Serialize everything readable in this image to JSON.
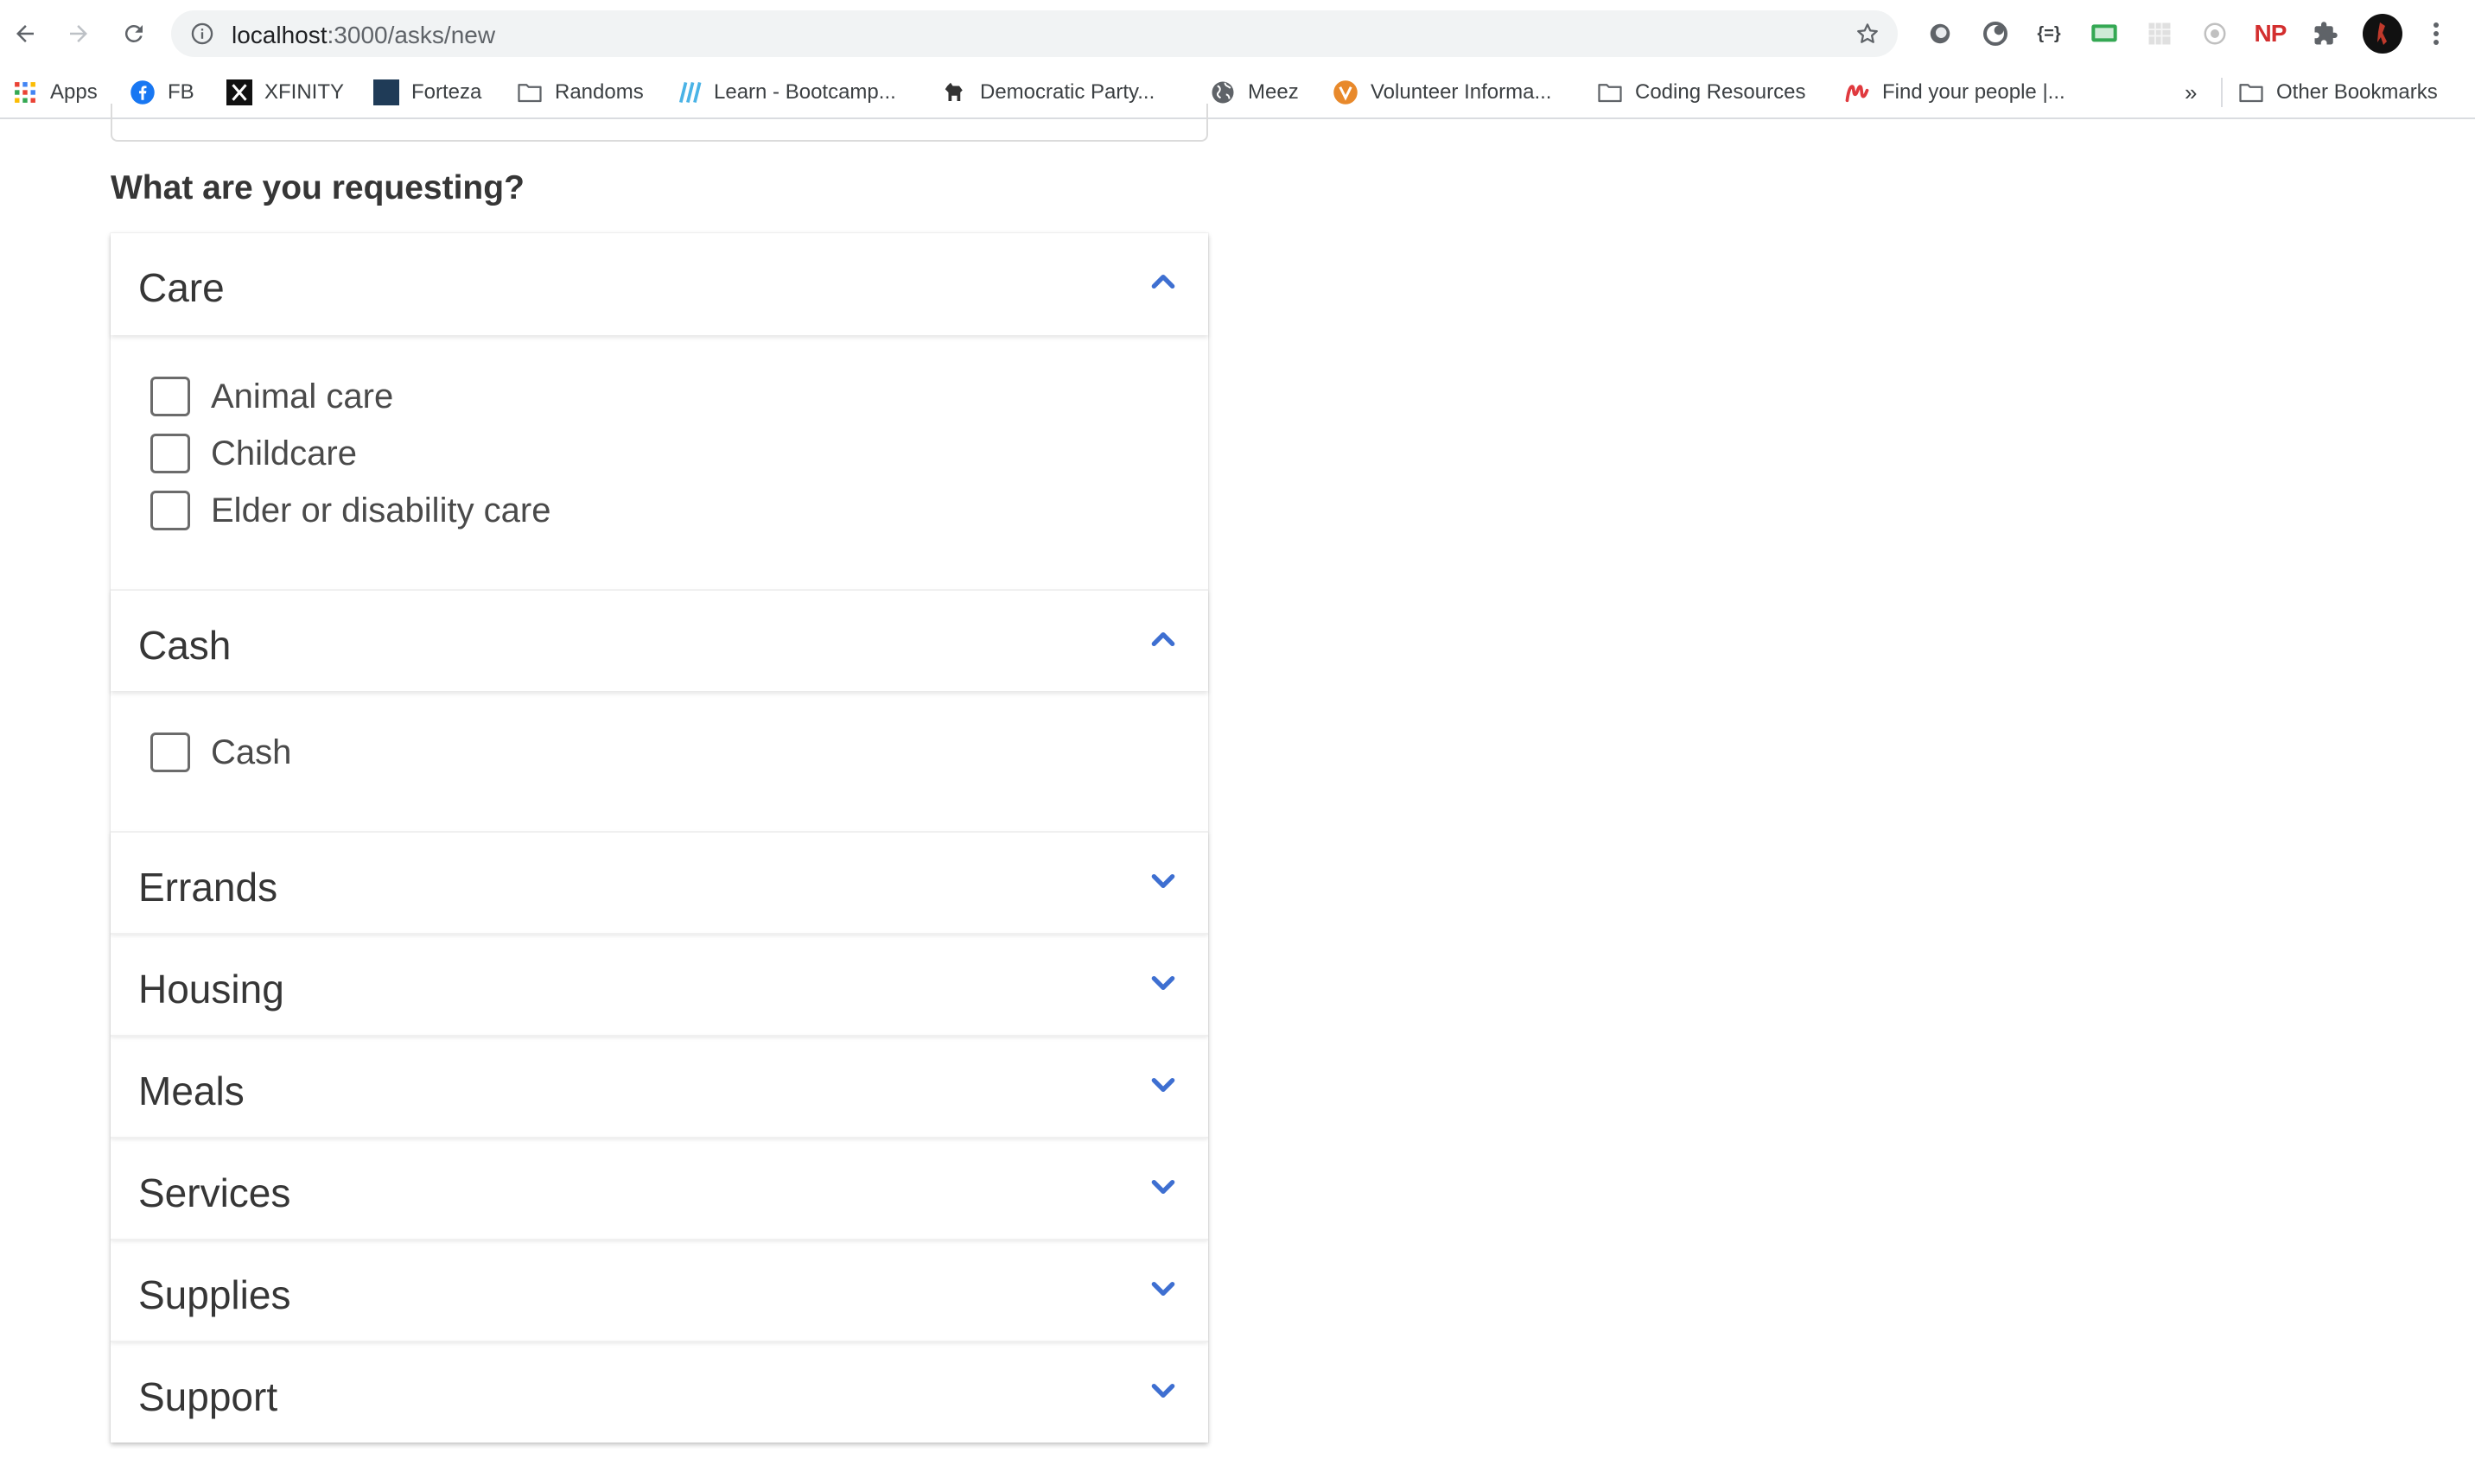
{
  "browser": {
    "url_host": "localhost",
    "url_path": ":3000/asks/new",
    "bookmarks": [
      {
        "label": "Apps"
      },
      {
        "label": "FB"
      },
      {
        "label": "XFINITY"
      },
      {
        "label": "Forteza"
      },
      {
        "label": "Randoms"
      },
      {
        "label": "Learn - Bootcamp..."
      },
      {
        "label": "Democratic Party..."
      },
      {
        "label": "Meez"
      },
      {
        "label": "Volunteer Informa..."
      },
      {
        "label": "Coding Resources"
      },
      {
        "label": "Find your people |..."
      }
    ],
    "overflow_label": "»",
    "other_bookmarks": "Other Bookmarks",
    "extension_np_label": "NP"
  },
  "form": {
    "question": "What are you requesting?",
    "sections": [
      {
        "title": "Care",
        "expanded": true,
        "options": [
          "Animal care",
          "Childcare",
          "Elder or disability care"
        ]
      },
      {
        "title": "Cash",
        "expanded": true,
        "options": [
          "Cash"
        ]
      },
      {
        "title": "Errands",
        "expanded": false
      },
      {
        "title": "Housing",
        "expanded": false
      },
      {
        "title": "Meals",
        "expanded": false
      },
      {
        "title": "Services",
        "expanded": false
      },
      {
        "title": "Supplies",
        "expanded": false
      },
      {
        "title": "Support",
        "expanded": false
      }
    ]
  },
  "colors": {
    "accent": "#3e6fd1",
    "text": "#363636",
    "checkbox_border": "#6b6b6b"
  }
}
